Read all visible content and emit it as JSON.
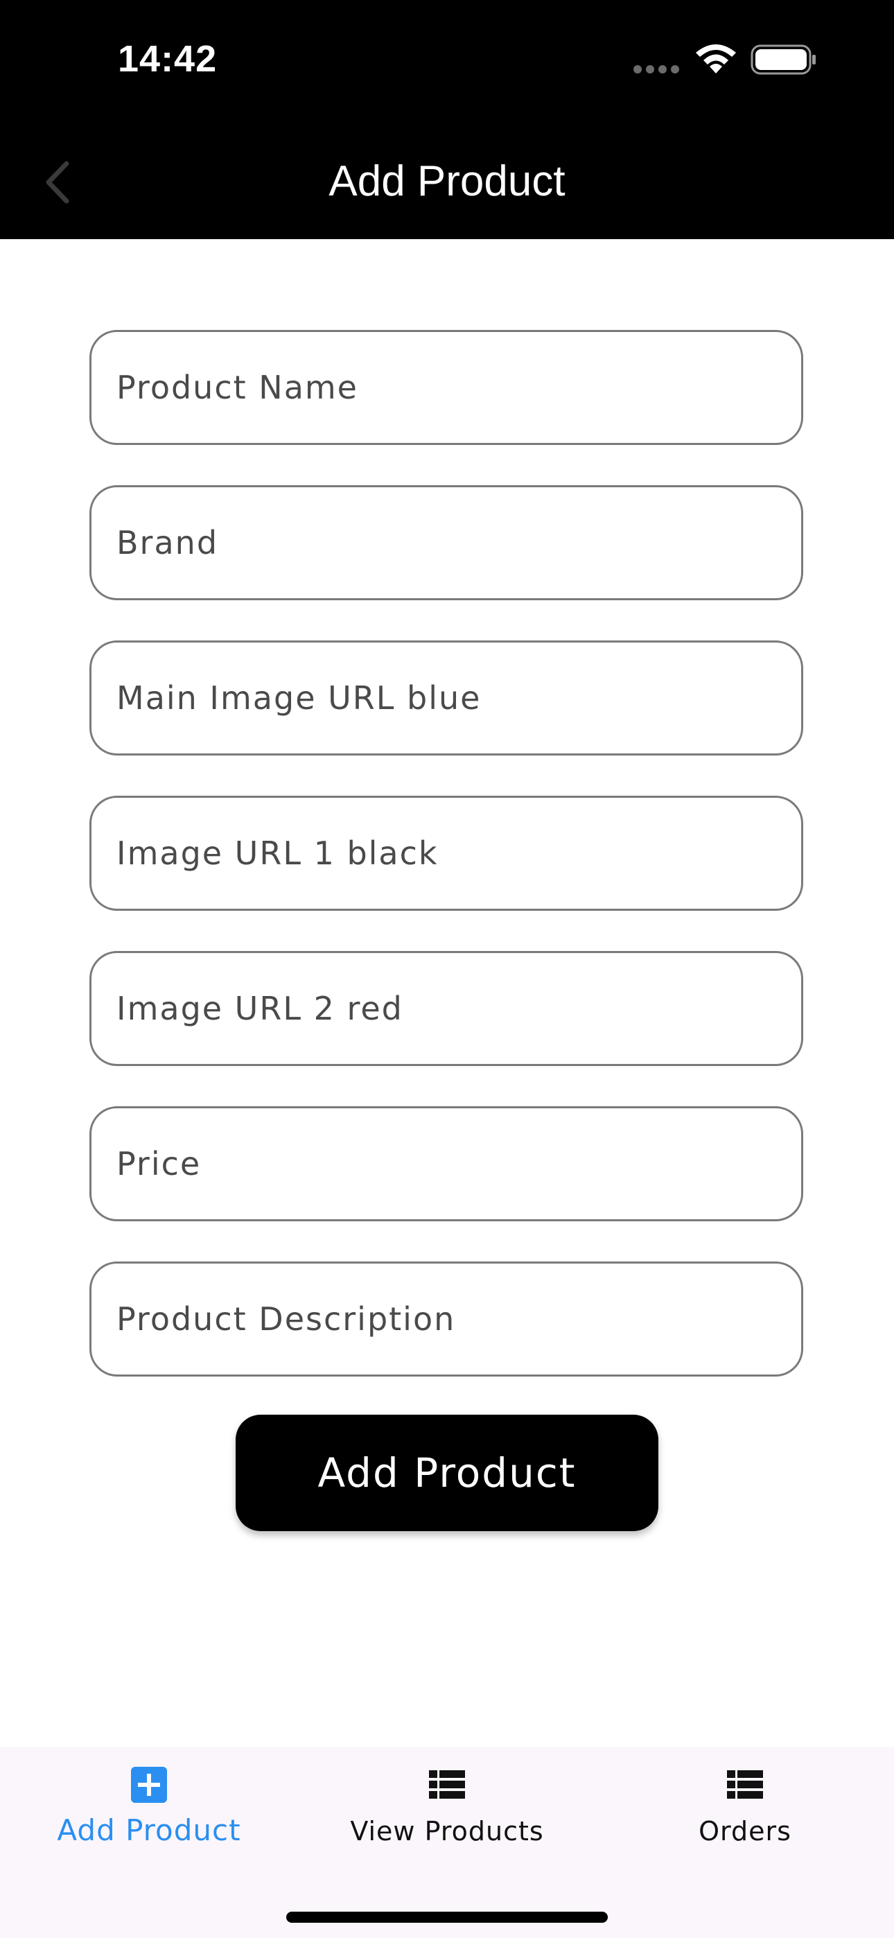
{
  "status_bar": {
    "time": "14:42"
  },
  "header": {
    "title": "Add Product",
    "back_icon": "chevron-left-icon"
  },
  "form": {
    "fields": [
      {
        "placeholder": "Product Name",
        "value": ""
      },
      {
        "placeholder": "Brand",
        "value": ""
      },
      {
        "placeholder": "Main Image URL blue",
        "value": ""
      },
      {
        "placeholder": "Image URL 1 black",
        "value": ""
      },
      {
        "placeholder": "Image URL 2 red",
        "value": ""
      },
      {
        "placeholder": "Price",
        "value": ""
      },
      {
        "placeholder": "Product Description",
        "value": ""
      }
    ],
    "submit_label": "Add Product"
  },
  "tabs": [
    {
      "label": "Add Product",
      "icon": "plus-square-icon",
      "active": true
    },
    {
      "label": "View Products",
      "icon": "list-icon",
      "active": false
    },
    {
      "label": "Orders",
      "icon": "list-icon",
      "active": false
    }
  ],
  "colors": {
    "header_bg": "#000000",
    "accent": "#2a8ff0",
    "tabbar_bg": "#fbf6fc",
    "field_border": "#7a7a7a"
  }
}
